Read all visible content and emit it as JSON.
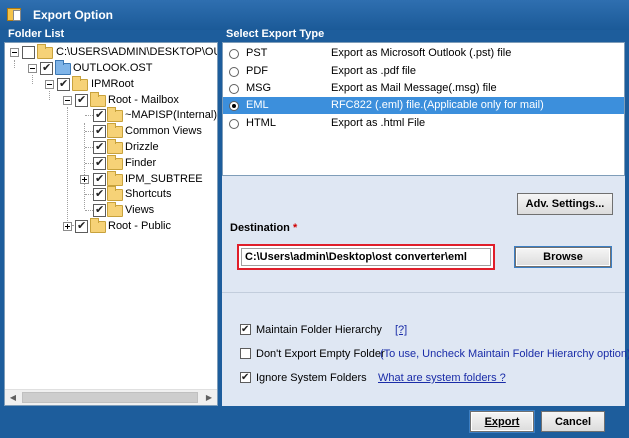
{
  "window": {
    "title": "Export Option"
  },
  "folder_panel": {
    "header": "Folder List",
    "nodes": [
      {
        "label": "C:\\USERS\\ADMIN\\DESKTOP\\OUTLOOK.OST",
        "expander": "minus",
        "checked": false,
        "icon": "folder-open-icon"
      },
      {
        "label": "OUTLOOK.OST",
        "expander": "minus",
        "checked": true,
        "icon": "data-file-icon"
      },
      {
        "label": "IPMRoot",
        "expander": "minus",
        "checked": true,
        "icon": "folder-icon"
      },
      {
        "label": "Root - Mailbox",
        "expander": "minus",
        "checked": true,
        "icon": "folder-icon"
      },
      {
        "label": "~MAPISP(Internal)",
        "expander": "none",
        "checked": true,
        "icon": "folder-icon"
      },
      {
        "label": "Common Views",
        "expander": "none",
        "checked": true,
        "icon": "folder-icon"
      },
      {
        "label": "Drizzle",
        "expander": "none",
        "checked": true,
        "icon": "folder-icon"
      },
      {
        "label": "Finder",
        "expander": "none",
        "checked": true,
        "icon": "folder-icon"
      },
      {
        "label": "IPM_SUBTREE",
        "expander": "plus",
        "checked": true,
        "icon": "folder-icon"
      },
      {
        "label": "Shortcuts",
        "expander": "none",
        "checked": true,
        "icon": "folder-icon"
      },
      {
        "label": "Views",
        "expander": "none",
        "checked": true,
        "icon": "folder-icon"
      },
      {
        "label": "Root - Public",
        "expander": "plus",
        "checked": true,
        "icon": "folder-icon"
      }
    ]
  },
  "export_panel": {
    "header": "Select Export Type",
    "options": [
      {
        "format": "PST",
        "description": "Export as Microsoft Outlook (.pst) file",
        "selected": false
      },
      {
        "format": "PDF",
        "description": "Export as .pdf file",
        "selected": false
      },
      {
        "format": "MSG",
        "description": "Export as Mail Message(.msg) file",
        "selected": false
      },
      {
        "format": "EML",
        "description": "RFC822 (.eml) file.(Applicable only for mail)",
        "selected": true
      },
      {
        "format": "HTML",
        "description": "Export as .html File",
        "selected": false
      }
    ],
    "adv_settings_label": "Adv. Settings...",
    "destination_label": "Destination",
    "required_mark": "*",
    "destination_value": "C:\\Users\\admin\\Desktop\\ost converter\\eml",
    "browse_label": "Browse"
  },
  "options": {
    "maintain_hierarchy": {
      "label": "Maintain Folder Hierarchy",
      "checked": true,
      "help": "[?]"
    },
    "no_empty_folders": {
      "label": "Don't Export Empty Folder",
      "checked": false,
      "note": "(To use, Uncheck Maintain Folder Hierarchy option)"
    },
    "ignore_system": {
      "label": "Ignore System Folders",
      "checked": true,
      "help": "What are system folders ?"
    }
  },
  "footer": {
    "export_label": "Export",
    "cancel_label": "Cancel"
  },
  "colors": {
    "frame": "#1d5d9c",
    "selection": "#3c8fdc",
    "highlight_border": "#e01e2a"
  }
}
